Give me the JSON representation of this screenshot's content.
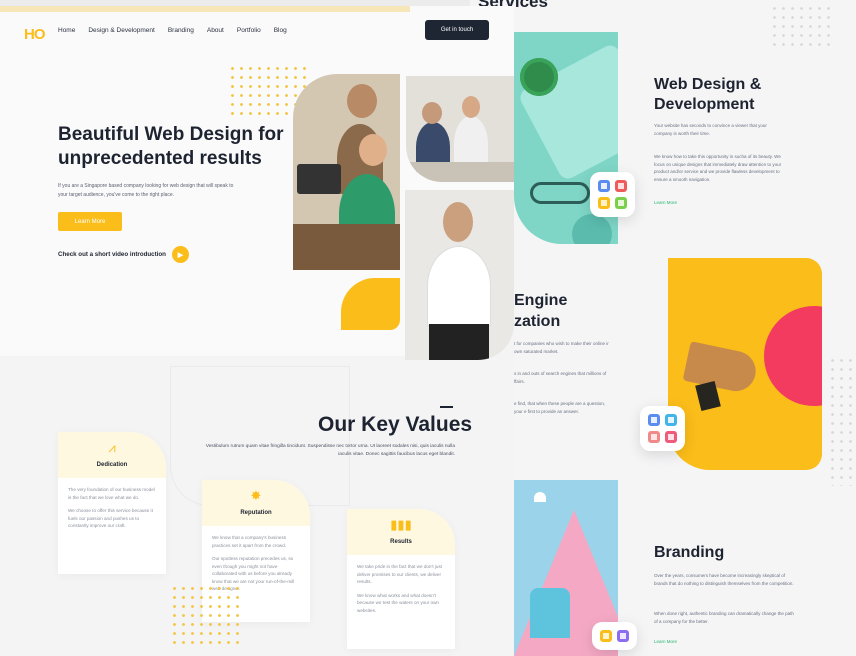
{
  "right": {
    "services_heading": "Services",
    "web_design": {
      "title": "Web Design & Development",
      "p1": "Your website has seconds to convince a viewer that your company is worth their time.",
      "p2": "We know how to take this opportunity in sucha of its beauty. We focus on unique designs that immediately draw attention to your product and/or service and we provide flawless development to ensure a smooth navigation.",
      "link": "Learn More"
    },
    "seo": {
      "title_partial": "Engine\nzation",
      "p1": "t for companies who wish to make their online ir own saturated market.",
      "p2": "s in and outs of search engines that millions of ffairs.",
      "p3": "e find, that when these people are a question, your e first to provide an answer."
    },
    "branding": {
      "title": "Branding",
      "p1": "Over the years, consumers have become increasingly skeptical of brands that do nothing to distinguish themselves from the competition.",
      "p2": "When done right, authentic branding can dramatically change the path of a company for the better.",
      "link": "Learn More"
    }
  },
  "header": {
    "logo": "HO",
    "nav": [
      "Home",
      "Design & Development",
      "Branding",
      "About",
      "Portfolio",
      "Blog"
    ],
    "cta": "Get in touch"
  },
  "hero": {
    "title": "Beautiful Web Design for unprecedented results",
    "text": "If you are a Singapore based company looking for web design that will speak to your target audience, you've come to the right place.",
    "learn_more": "Learn More",
    "video_link": "Check out a short video introduction"
  },
  "key_values": {
    "title": "Our Key Values",
    "text": "Vestibulum rutrum quam vitae fringilla tincidunt. Suspendisse nec tortor urna. Ut laoreet sodales nisi, quis iaculis nulla iaculis vitae. Donec sagittis faucibus lacus eget blandit.",
    "cards": [
      {
        "label": "Dedication",
        "p1": "The very foundation of our business model is the fact that we love what we do.",
        "p2": "We choose to offer this service because it fuels our passion and pushes us to constantly improve our craft."
      },
      {
        "label": "Reputation",
        "p1": "We know that a company's business practices set it apart from the crowd.",
        "p2": "Our spotless reputation precedes us, so even though you might not have collaborated with us before you already know that we are not your run-of-the-mill web designer."
      },
      {
        "label": "Results",
        "p1": "We take pride in the fact that we don't just deliver promises to our clients, we deliver results.",
        "p2": "We know what works and what doesn't because we test the waters on your own websites."
      }
    ]
  },
  "colors": {
    "accent": "#fbbd19",
    "dark": "#1f2633",
    "teal": "#7fd6c6",
    "pink": "#f23b5f"
  }
}
